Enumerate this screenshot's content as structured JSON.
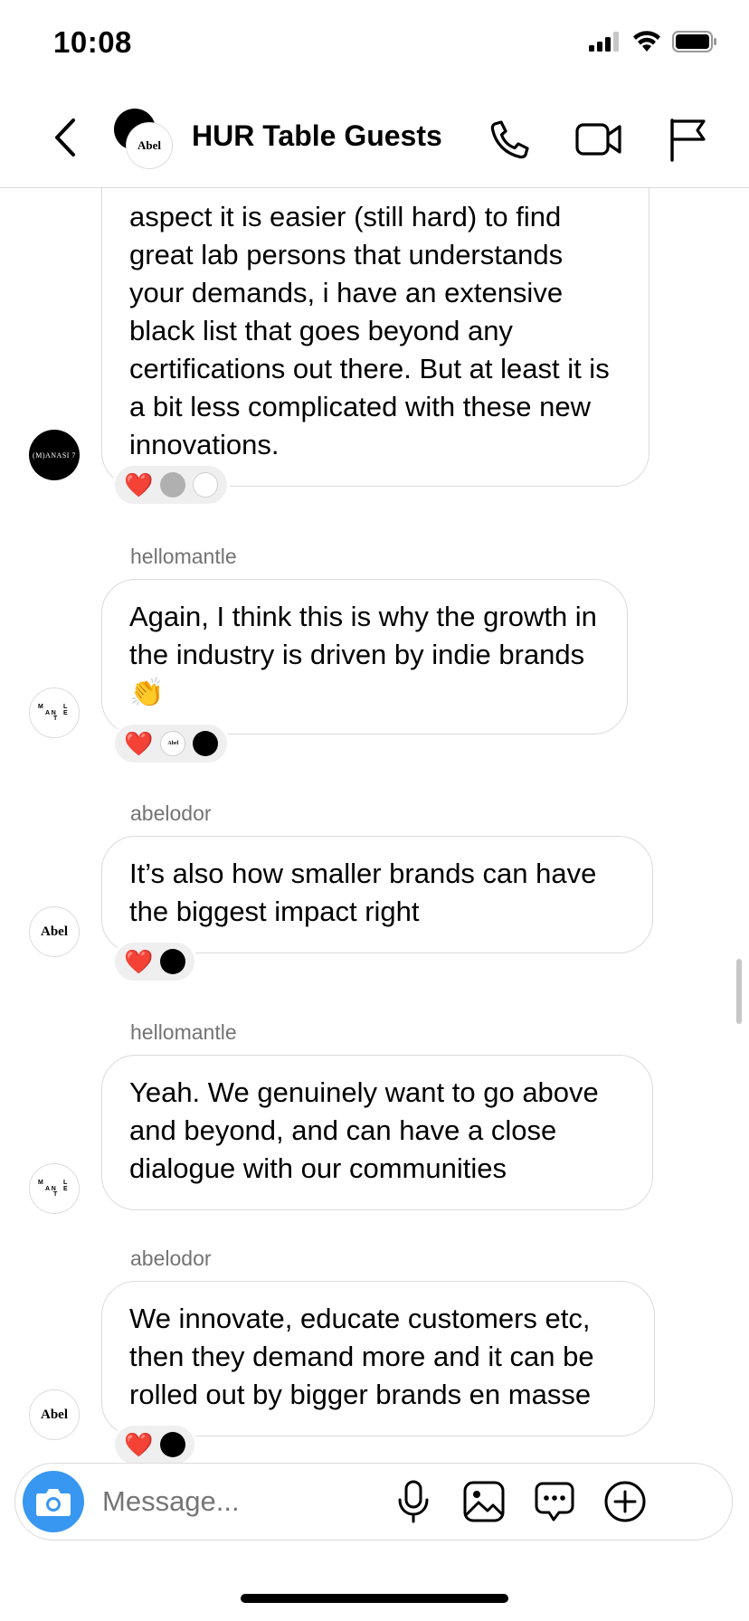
{
  "status_bar": {
    "time": "10:08"
  },
  "header": {
    "title": "HUR Table Guests",
    "front_avatar_text": "Abel"
  },
  "messages": [
    {
      "sender": "",
      "text": "aspect it is easier (still hard) to find great lab persons that understands your demands, i have an extensive black list that goes beyond any certifications out there. But at least it is a bit less complicated with these new innovations.",
      "avatar_label": "(M)ANASI 7",
      "reactions": [
        "❤️"
      ]
    },
    {
      "sender": "hellomantle",
      "text": "Again, I think this is why the growth in the industry is driven by indie brands 👏",
      "avatar_label": "MANTLE",
      "reactions": [
        "❤️"
      ]
    },
    {
      "sender": "abelodor",
      "text": "It’s also how smaller brands can have the biggest impact right",
      "avatar_label": "Abel",
      "reactions": [
        "❤️"
      ]
    },
    {
      "sender": "hellomantle",
      "text": "Yeah. We genuinely want to go above and beyond, and can have a close dialogue with our communities",
      "avatar_label": "MANTLE",
      "reactions": []
    },
    {
      "sender": "abelodor",
      "text": "We innovate, educate customers etc, then they demand more and it can be rolled out by bigger brands en masse",
      "avatar_label": "Abel",
      "reactions": [
        "❤️"
      ]
    }
  ],
  "reaction_avatar_labels": {
    "abel": "Abel"
  },
  "composer": {
    "placeholder": "Message..."
  },
  "colors": {
    "accent": "#3897f0",
    "border": "#dbdbdb",
    "secondary_text": "#737373",
    "heart": "#ed1c24"
  },
  "icons": {
    "back": "chevron-left-icon",
    "call": "phone-icon",
    "video": "video-camera-icon",
    "report": "flag-icon",
    "camera": "camera-icon",
    "mic": "microphone-icon",
    "gallery": "image-icon",
    "sticker": "chat-bubble-icon",
    "more": "plus-circle-icon"
  }
}
